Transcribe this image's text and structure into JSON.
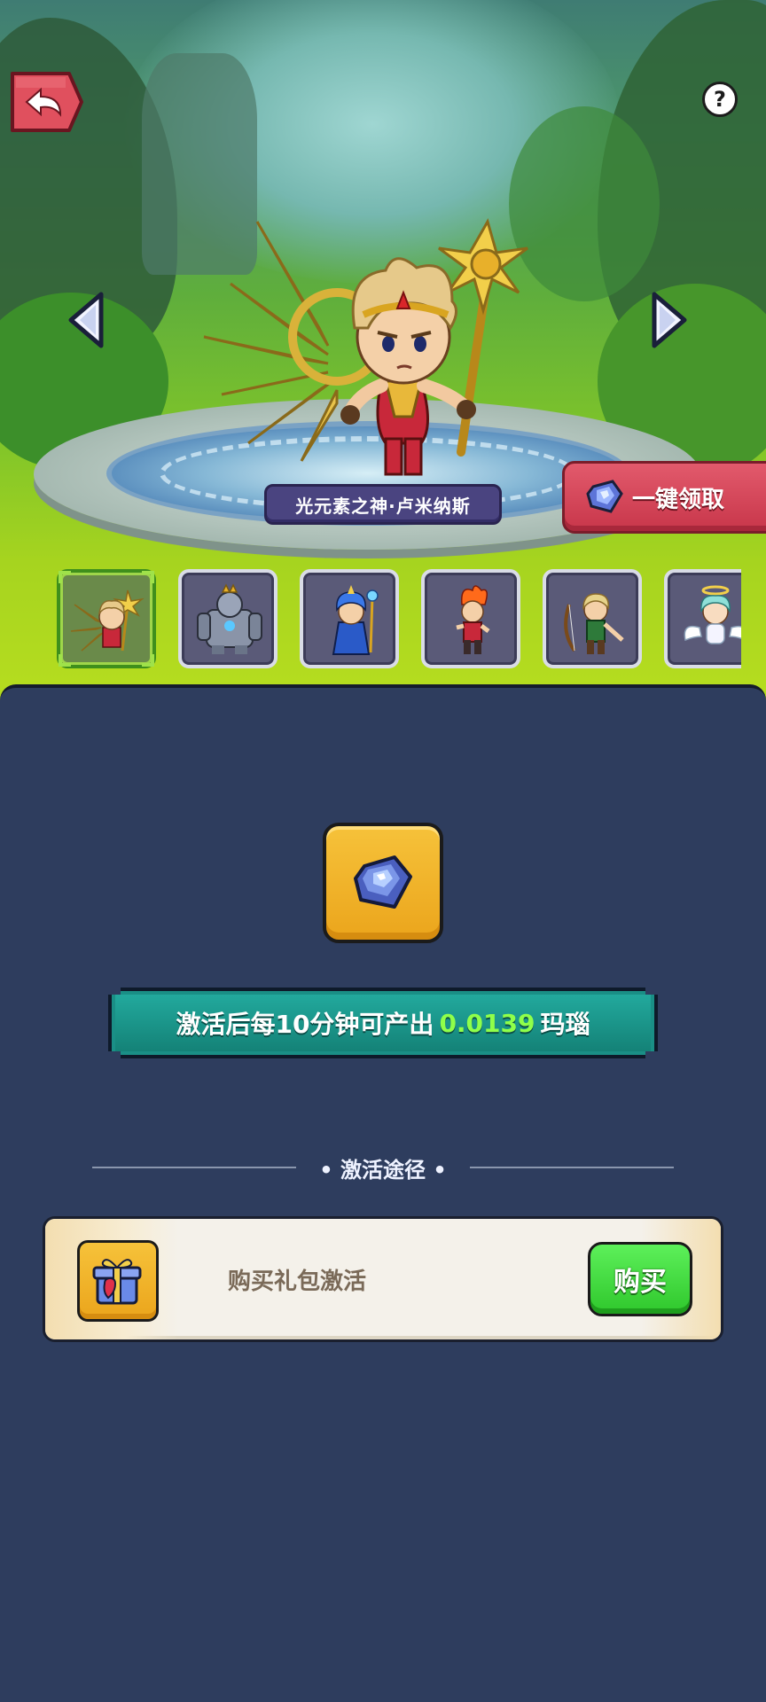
{
  "header": {
    "back_icon": "return-arrow-icon",
    "help_label": "?"
  },
  "hero_showcase": {
    "hero_name": "光元素之神·卢米纳斯",
    "prev_icon": "arrow-left-icon",
    "next_icon": "arrow-right-icon",
    "claim_all_label": "一键领取",
    "claim_icon": "gem-icon"
  },
  "hero_list": {
    "thumbnails": [
      {
        "id": "light-god",
        "selected": true
      },
      {
        "id": "stone-golem",
        "selected": false
      },
      {
        "id": "blue-mage",
        "selected": false
      },
      {
        "id": "fire-warrior",
        "selected": false
      },
      {
        "id": "elf-archer",
        "selected": false
      },
      {
        "id": "angel",
        "selected": false
      }
    ]
  },
  "reward": {
    "icon": "agate-gem-icon",
    "text_before": "激活后每10分钟可产出",
    "amount": "0.0139",
    "unit": "玛瑙"
  },
  "activation": {
    "section_title": "• 激活途径 •",
    "method_icon": "gift-pack-icon",
    "method_label": "购买礼包激活",
    "buy_label": "购买"
  },
  "colors": {
    "panel_bg": "#2e3d5e",
    "banner_teal": "#1a8f86",
    "highlight_green": "#8fff4a",
    "buy_green": "#2fc72c",
    "claim_red": "#c8364a",
    "gold": "#eba51c"
  }
}
